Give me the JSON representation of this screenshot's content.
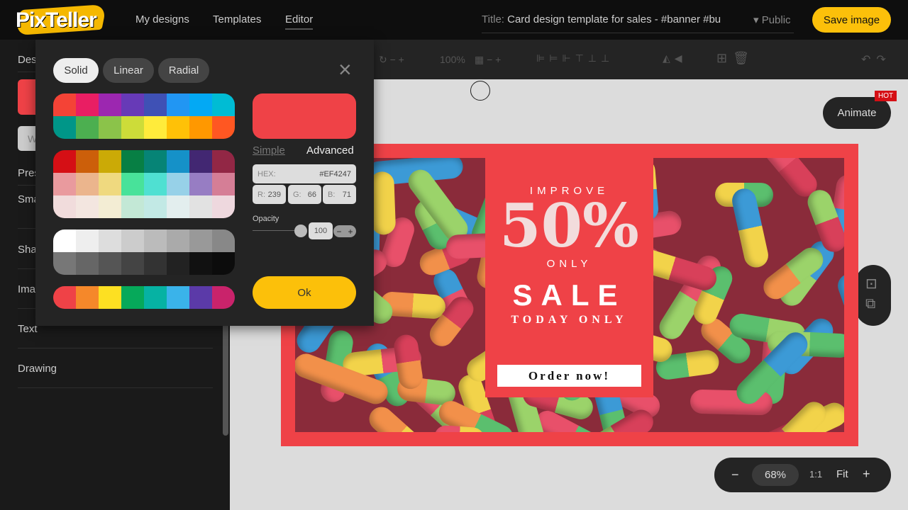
{
  "header": {
    "logo": "PixTeller",
    "nav": [
      "My designs",
      "Templates",
      "Editor"
    ],
    "title_label": "Title:",
    "title_value": "Card design template for sales - #banner #bu",
    "visibility": "Public",
    "save_label": "Save image"
  },
  "sidebar": {
    "items": [
      "Des",
      "Pres",
      "Sma",
      "Sha",
      "Ima",
      "Text",
      "Drawing"
    ],
    "button_fragment": "W",
    "current_color": "#EF4247"
  },
  "toolbar": {
    "zoom": "100%"
  },
  "color_picker": {
    "tabs": [
      "Solid",
      "Linear",
      "Radial"
    ],
    "active_tab": "Solid",
    "palettes": [
      [
        "#f44336",
        "#e91e63",
        "#9c27b0",
        "#673ab7",
        "#3f51b5",
        "#2196f3",
        "#03a9f4",
        "#00bcd4",
        "#009688",
        "#4caf50",
        "#8bc34a",
        "#cddc39",
        "#ffeb3b",
        "#ffc107",
        "#ff9800",
        "#ff5722"
      ],
      [
        "#d50f15",
        "#cc5f0a",
        "#cbaa06",
        "#077f44",
        "#068476",
        "#1591c8",
        "#422772",
        "#922745",
        "#e99a9e",
        "#ebb58d",
        "#efd97f",
        "#48e29a",
        "#4fe0d2",
        "#97d1e8",
        "#977dc3",
        "#d57e96",
        "#f1dcdc",
        "#f3e6e0",
        "#f3edd4",
        "#c3e8d6",
        "#c2e9e5",
        "#e3eeee",
        "#e2e2e2",
        "#eed8de"
      ],
      [
        "#ffffff",
        "#eeeeee",
        "#dddddd",
        "#cccccc",
        "#bbbbbb",
        "#aaaaaa",
        "#999999",
        "#888888",
        "#777777",
        "#666666",
        "#555555",
        "#444444",
        "#333333",
        "#222222",
        "#111111",
        "#0c0c0c"
      ],
      [
        "#ef4247",
        "#f5882a",
        "#fde022",
        "#06a95a",
        "#06b2a3",
        "#3ab3ea",
        "#5b3aa8",
        "#c9236b"
      ]
    ],
    "modes": [
      "Simple",
      "Advanced"
    ],
    "hex_label": "HEX:",
    "hex": "#EF4247",
    "r_label": "R:",
    "r": "239",
    "g_label": "G:",
    "g": "66",
    "b_label": "B:",
    "b": "71",
    "opacity_label": "Opacity",
    "opacity": "100",
    "minus": "−",
    "plus": "+",
    "ok_label": "Ok",
    "close": "×",
    "selected_color": "#ef4247"
  },
  "design": {
    "line1": "IMPROVE",
    "line2": "50%",
    "line3": "ONLY",
    "line4": "SALE",
    "line5": "TODAY ONLY",
    "cta": "Order now!",
    "bg_color": "#ef4247"
  },
  "animate": {
    "label": "Animate",
    "badge": "HOT"
  },
  "zoom_controls": {
    "minus": "−",
    "value": "68%",
    "one_to_one": "1:1",
    "fit": "Fit",
    "plus": "+"
  }
}
